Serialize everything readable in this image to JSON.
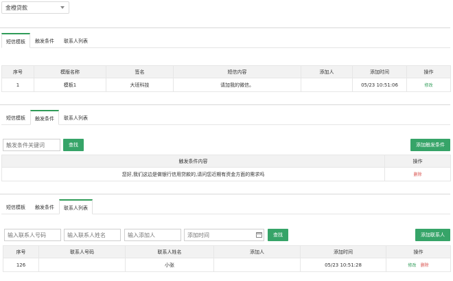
{
  "selector": {
    "value": "金橙贷款"
  },
  "tabs": {
    "sms": "短信模板",
    "trigger": "触发条件",
    "contacts": "联系人列表"
  },
  "template_table": {
    "headers": [
      "序号",
      "模版名称",
      "签名",
      "短信内容",
      "添加人",
      "添加时间",
      "操作"
    ],
    "rows": [
      {
        "no": "1",
        "name": "模板1",
        "sign": "大班科技",
        "content": "请加我的微信。",
        "adder": "",
        "time": "05/23 10:51:06",
        "action": "修改"
      }
    ]
  },
  "trigger": {
    "search_placeholder": "触发条件关键词",
    "search_button": "查找",
    "add_button": "添加触发条件",
    "headers": [
      "触发条件内容",
      "操作"
    ],
    "rows": [
      {
        "content": "您好,我们这边是做银行信用贷款的,请问您近期有资金方面的需求吗",
        "action": "删除"
      }
    ]
  },
  "contacts": {
    "phone_placeholder": "输入联系人号码",
    "name_placeholder": "输入联系人姓名",
    "adder_placeholder": "输入添加人",
    "time_placeholder": "添加时间",
    "search_button": "查找",
    "add_button": "添加联系人",
    "headers": [
      "序号",
      "联系人号码",
      "联系人姓名",
      "添加人",
      "添加时间",
      "操作"
    ],
    "rows": [
      {
        "no": "126",
        "phone": "",
        "name": "小张",
        "adder": "",
        "time": "05/23 10:51:28",
        "edit": "修改",
        "delete": "删除"
      }
    ]
  },
  "colors": {
    "accent": "#36a468",
    "danger": "#d9534f",
    "header_bg": "#f2f2f2"
  }
}
